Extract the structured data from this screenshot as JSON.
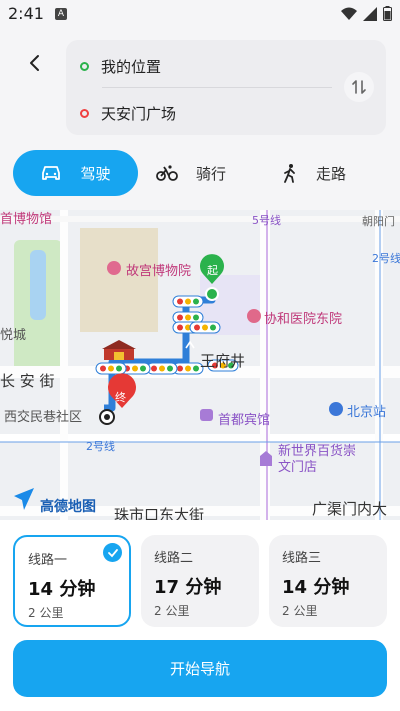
{
  "status_bar": {
    "time": "2:41",
    "notification_glyph": "A",
    "icons": [
      "wifi-icon",
      "signal-icon",
      "battery-icon"
    ]
  },
  "header": {
    "origin": "我的位置",
    "destination": "天安门广场",
    "back_icon": "chevron-left-icon",
    "swap_icon": "swap-vertical-icon",
    "modes": [
      {
        "label": "驾驶",
        "icon": "car-icon",
        "active": true
      },
      {
        "label": "骑行",
        "icon": "bicycle-icon",
        "active": false
      },
      {
        "label": "走路",
        "icon": "walk-icon",
        "active": false
      }
    ]
  },
  "map": {
    "labels": {
      "museum_top": "首博物馆",
      "palace": "故宫博物院",
      "start_marker": "起",
      "end_marker": "终",
      "line5": "5号线",
      "chaoyang": "朝阳门",
      "line2_right": "2号线",
      "hospital": "协和医院东院",
      "yuelake": "悦城",
      "wangfujing": "王府井",
      "changan": "长 安 街",
      "xijiao": "西交民巷社区",
      "capital_hotel": "首都宾馆",
      "beijing_station": "北京站",
      "line2_bottom": "2号线",
      "xinshijie": "新世界百货崇文门店",
      "zhushikou": "珠市口东大街",
      "guangqu": "广渠门内大",
      "gaode_logo": "高德地图"
    }
  },
  "routes": [
    {
      "name": "线路一",
      "time": "14 分钟",
      "distance": "2 公里",
      "selected": true
    },
    {
      "name": "线路二",
      "time": "17 分钟",
      "distance": "2 公里",
      "selected": false
    },
    {
      "name": "线路三",
      "time": "14 分钟",
      "distance": "2 公里",
      "selected": false
    }
  ],
  "start_navigation_label": "开始导航",
  "colors": {
    "accent": "#17a5f0",
    "origin_dot": "#2bb24c",
    "destination_dot": "#ef4040",
    "route_line": "#2f7fd8"
  }
}
